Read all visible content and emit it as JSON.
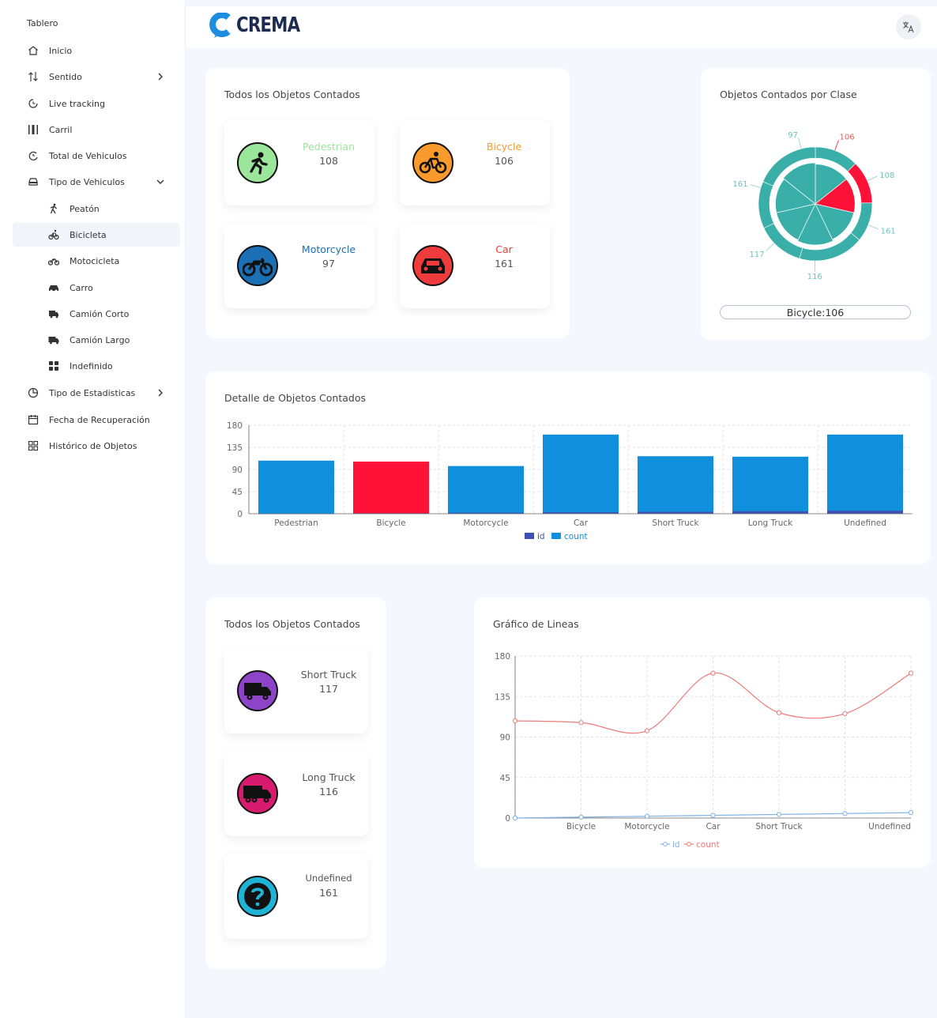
{
  "header": {
    "brand": "CREMA",
    "translate_icon": "translate-icon"
  },
  "sidebar": {
    "title": "Tablero",
    "items": [
      {
        "label": "Inicio",
        "icon": "home-icon"
      },
      {
        "label": "Sentido",
        "icon": "sort-arrows-icon"
      },
      {
        "label": "Live tracking",
        "icon": "clock-play-icon"
      },
      {
        "label": "Carril",
        "icon": "lane-icon"
      },
      {
        "label": "Total de Vehiculos",
        "icon": "history-icon"
      },
      {
        "label": "Tipo de Vehiculos",
        "icon": "car-icon"
      },
      {
        "label": "Peatón",
        "icon": "walk-icon"
      },
      {
        "label": "Bicicleta",
        "icon": "bike-icon"
      },
      {
        "label": "Motocicleta",
        "icon": "motorcycle-icon"
      },
      {
        "label": "Carro",
        "icon": "car-icon"
      },
      {
        "label": "Camión Corto",
        "icon": "truck-icon"
      },
      {
        "label": "Camión Largo",
        "icon": "truck-icon"
      },
      {
        "label": "Indefinido",
        "icon": "grid-icon"
      },
      {
        "label": "Tipo de Estadisticas",
        "icon": "pie-icon"
      },
      {
        "label": "Fecha de Recuperación",
        "icon": "calendar-icon"
      },
      {
        "label": "Histórico de Objetos",
        "icon": "apps-icon"
      }
    ]
  },
  "card_objects": {
    "title": "Todos los Objetos Contados",
    "tiles": [
      {
        "label": "Pedestrian",
        "count": "108",
        "color": "#9be69b"
      },
      {
        "label": "Bicycle",
        "count": "106",
        "color": "#f89a2c"
      },
      {
        "label": "Motorcycle",
        "count": "97",
        "color": "#1b6fb5"
      },
      {
        "label": "Car",
        "count": "161",
        "color": "#ee3b3b"
      }
    ]
  },
  "card_pie": {
    "title": "Objetos Contados por Clase",
    "labels": [
      "97",
      "106",
      "108",
      "161",
      "116",
      "117",
      "161"
    ],
    "selected": "Bicycle:106"
  },
  "card_bar": {
    "title": "Detalle de Objetos Contados",
    "legend": [
      "id",
      "count"
    ]
  },
  "card_objects2": {
    "title": "Todos los Objetos Contados",
    "tiles": [
      {
        "label": "Short Truck",
        "count": "117",
        "color": "#8e44c9"
      },
      {
        "label": "Long Truck",
        "count": "116",
        "color": "#d81b6e"
      },
      {
        "label": "Undefined",
        "count": "161",
        "color": "#1fb3d6"
      }
    ]
  },
  "card_line": {
    "title": "Gráfico de Lineas",
    "legend": [
      "id",
      "count"
    ]
  },
  "chart_data": [
    {
      "type": "pie",
      "categories": [
        "Pedestrian",
        "Bicycle",
        "Motorcycle",
        "Car",
        "Short Truck",
        "Long Truck",
        "Undefined"
      ],
      "values": [
        108,
        106,
        97,
        161,
        117,
        116,
        161
      ],
      "highlighted": "Bicycle"
    },
    {
      "type": "bar",
      "categories": [
        "Pedestrian",
        "Bicycle",
        "Motorcycle",
        "Car",
        "Short Truck",
        "Long Truck",
        "Undefined"
      ],
      "series": [
        {
          "name": "id",
          "values": [
            0,
            1,
            2,
            3,
            4,
            5,
            6
          ]
        },
        {
          "name": "count",
          "values": [
            108,
            106,
            97,
            161,
            117,
            116,
            161
          ]
        }
      ],
      "highlighted": "Bicycle",
      "ylim": [
        0,
        180
      ],
      "yticks": [
        0,
        45,
        90,
        135,
        180
      ],
      "grid": true,
      "legend": "bottom"
    },
    {
      "type": "line",
      "categories": [
        "Pedestrian",
        "Bicycle",
        "Motorcycle",
        "Car",
        "Short Truck",
        "Long Truck",
        "Undefined"
      ],
      "xtick_labels": [
        "",
        "Bicycle",
        "Motorcycle",
        "Car",
        "Short Truck",
        "",
        "Undefined"
      ],
      "series": [
        {
          "name": "id",
          "values": [
            0,
            1,
            2,
            3,
            4,
            5,
            6
          ]
        },
        {
          "name": "count",
          "values": [
            108,
            106,
            97,
            161,
            117,
            116,
            161
          ]
        }
      ],
      "ylim": [
        0,
        180
      ],
      "yticks": [
        0,
        45,
        90,
        135,
        180
      ],
      "grid": true,
      "legend": "bottom"
    }
  ],
  "colors": {
    "bar": "#108fdc",
    "highlight": "#ff1237",
    "teal": "#3aaea8",
    "id": "#3f51b5",
    "line_count": "#ef7a7a",
    "line_id": "#7fb2e5"
  }
}
